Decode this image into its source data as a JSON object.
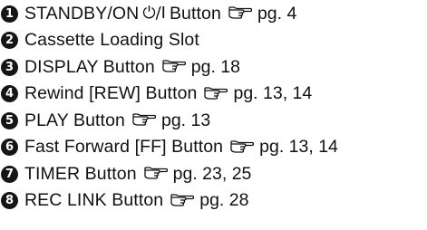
{
  "items": [
    {
      "number": "1",
      "label": "STANDBY/ON",
      "symbol": "⏻/I",
      "suffix": "Button",
      "page_ref": "pg. 4"
    },
    {
      "number": "2",
      "label": "Cassette Loading Slot"
    },
    {
      "number": "3",
      "label": "DISPLAY Button",
      "page_ref": "pg. 18"
    },
    {
      "number": "4",
      "label": "Rewind [REW] Button",
      "page_ref": "pg. 13, 14"
    },
    {
      "number": "5",
      "label": "PLAY Button",
      "page_ref": "pg. 13"
    },
    {
      "number": "6",
      "label": "Fast Forward [FF] Button",
      "page_ref": "pg. 13, 14"
    },
    {
      "number": "7",
      "label": "TIMER Button",
      "page_ref": "pg. 23, 25"
    },
    {
      "number": "8",
      "label": "REC LINK Button",
      "page_ref": "pg. 28"
    }
  ],
  "icons": {
    "pointing_hand": "pointing-hand-icon"
  }
}
